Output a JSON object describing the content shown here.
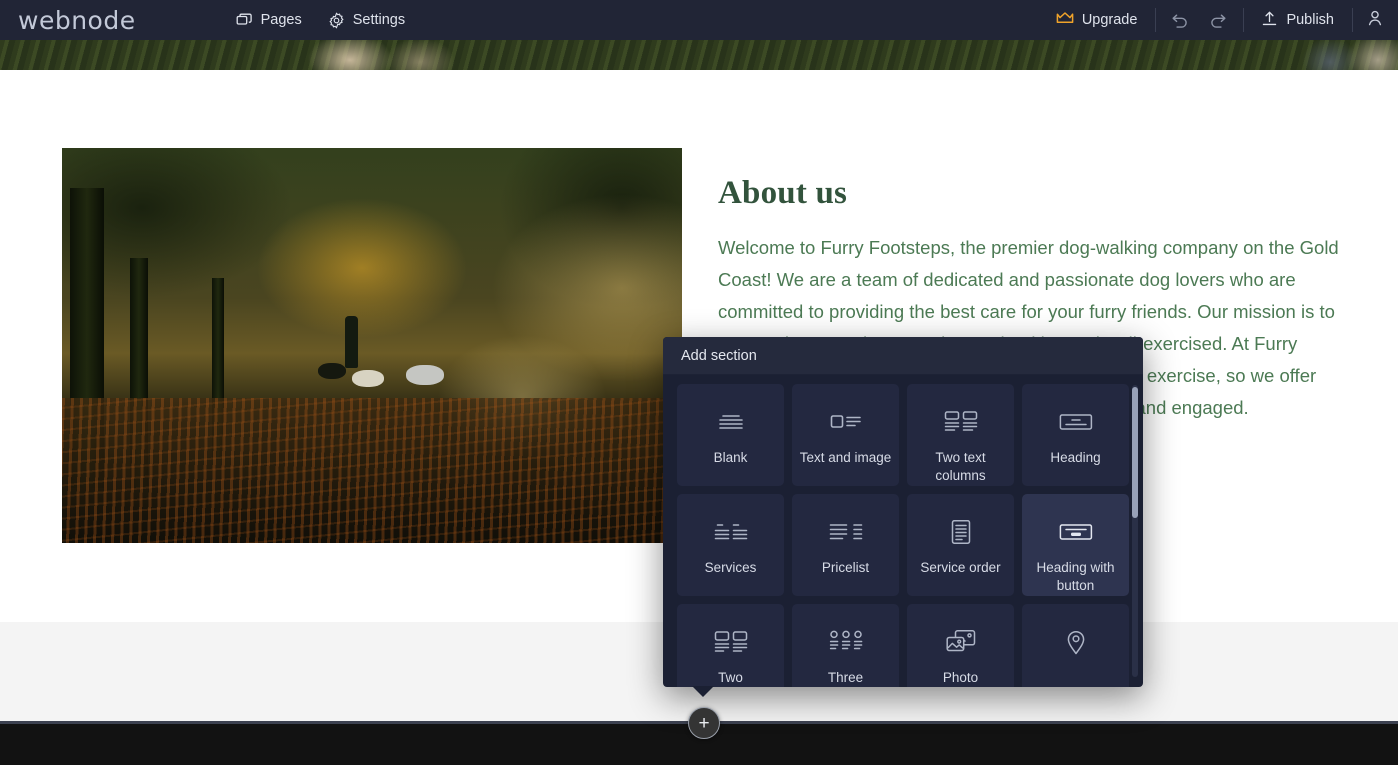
{
  "editor_bar": {
    "brand": "webnode",
    "nav": [
      {
        "label": "Pages",
        "icon": "pages-icon"
      },
      {
        "label": "Settings",
        "icon": "gear-icon"
      }
    ],
    "upgrade_label": "Upgrade",
    "publish_label": "Publish",
    "undo_icon": "undo-icon",
    "redo_icon": "redo-icon",
    "account_icon": "user-icon",
    "upgrade_icon": "crown-icon",
    "publish_icon": "upload-icon",
    "colors": {
      "bar_background": "#212536",
      "upgrade_accent": "#f0a32a",
      "text": "#dfe3ec"
    }
  },
  "site": {
    "about": {
      "heading": "About us",
      "body": "Welcome to Furry Footsteps, the premier dog-walking company on the Gold Coast! We are a team of dedicated and passionate dog lovers who are committed to providing the best care for your furry friends. Our mission is to ensure that your dogs stay happy, healthy, and well-exercised. At Furry Footsteps, we understand the importance of regular exercise, so we offer daily walks, rain or shine, to keep your pups active and engaged."
    },
    "photo_alt": "autumn-park-dog-walker-photo",
    "hero_alt": "grass-field-banner-photo",
    "colors": {
      "heading": "#32533c",
      "body_text": "#4c7a54",
      "grey_band": "#f4f4f4",
      "footer": "#121212"
    }
  },
  "add_button": {
    "label": "+"
  },
  "add_section_panel": {
    "title": "Add section",
    "selected_tile": "Heading with button",
    "tiles": [
      {
        "label": "Blank",
        "icon": "blank-lines-icon"
      },
      {
        "label": "Text and image",
        "icon": "text-and-image-icon"
      },
      {
        "label": "Two text columns",
        "icon": "two-text-columns-icon"
      },
      {
        "label": "Heading",
        "icon": "heading-icon"
      },
      {
        "label": "Services",
        "icon": "services-icon"
      },
      {
        "label": "Pricelist",
        "icon": "pricelist-icon"
      },
      {
        "label": "Service order",
        "icon": "service-order-icon"
      },
      {
        "label": "Heading with button",
        "icon": "heading-with-button-icon"
      },
      {
        "label": "Two",
        "icon": "two-columns-icon"
      },
      {
        "label": "Three",
        "icon": "three-columns-icon"
      },
      {
        "label": "Photo",
        "icon": "photo-gallery-icon"
      },
      {
        "label": "",
        "icon": "map-pin-icon"
      }
    ],
    "colors": {
      "panel_background": "#1b2033",
      "header_background": "#252a3d",
      "tile_background": "#232840",
      "tile_selected_background": "#2e3450",
      "scrollbar_thumb": "#98a1b8"
    }
  }
}
